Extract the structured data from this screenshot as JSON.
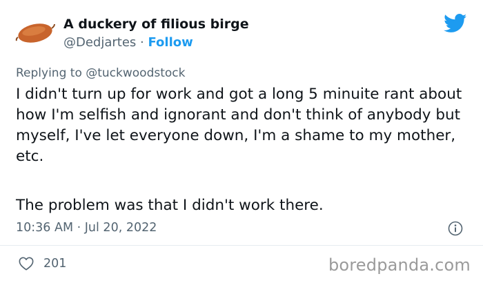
{
  "author": {
    "display_name": "A duckery of filious birge",
    "handle": "@Dedjartes",
    "separator": " · ",
    "follow_label": "Follow",
    "avatar_icon": "sweet-potato-avatar"
  },
  "reply_context": "Replying to @tuckwoodstock",
  "tweet": {
    "paragraph_1": "I didn't turn up for work and got a long 5 minuite rant about how I'm selfish and ignorant and don't think of anybody but myself, I've let everyone down, I'm a shame to my mother, etc.",
    "paragraph_2": "The problem was that I didn't work there.",
    "timestamp": "10:36 AM · Jul 20, 2022"
  },
  "engagement": {
    "like_count": "201",
    "like_icon": "heart-icon",
    "info_icon": "info-icon"
  },
  "branding": {
    "platform_icon": "twitter-bird-icon",
    "watermark": "boredpanda.com"
  },
  "colors": {
    "accent": "#1d9bf0",
    "secondary_text": "#536471",
    "primary_text": "#0f1419",
    "watermark": "#9a9a9a"
  }
}
